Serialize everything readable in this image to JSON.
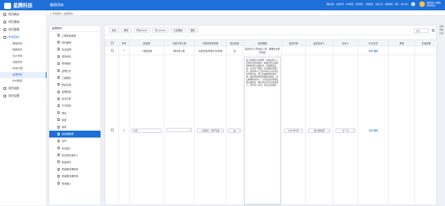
{
  "app": {
    "brand": "星腾科技",
    "brand_sub": "XINGTENG TECHNOLOGY",
    "project": "策网项目"
  },
  "topbar": {
    "items": [
      "模板切换",
      "在线打印",
      "BIM模型",
      "项目统计",
      "归档模式",
      "在线工具",
      "编辑资料",
      "图片",
      "账户中心"
    ],
    "user_name": "策网用户(游客)",
    "user_role": "建筑单位"
  },
  "sidebar": {
    "items": [
      {
        "label": "项目概况",
        "icon": "home-icon"
      },
      {
        "label": "项目基础",
        "icon": "grid-icon"
      },
      {
        "label": "项目管理",
        "icon": "folder-icon"
      },
      {
        "label": "专项资料",
        "icon": "file-icon",
        "open": true
      }
    ],
    "subitems": [
      "基础资料",
      "勘察资料",
      "设计资料",
      "流程资料",
      "现场代理",
      "监理资料",
      "BIM数据"
    ],
    "active_sub": "监理资料",
    "bottom_items": [
      {
        "label": "项目组织",
        "icon": "org-icon"
      },
      {
        "label": "项目设置",
        "icon": "gear-icon"
      }
    ]
  },
  "breadcrumb": {
    "home": "专项资料",
    "current": "监理资料"
  },
  "tree": {
    "title": "监理资料",
    "items": [
      "工程质量管理",
      "材料管理",
      "安全监理",
      "现场动态",
      "现场组织",
      "监理日志",
      "工程报告",
      "例会实施",
      "监理检验",
      "会议记录",
      "平行检验",
      "旁站",
      "巡视",
      "验收",
      "危险源管理",
      "合同",
      "安全施工",
      "安全责任承担人",
      "质量责任",
      "质量整改通知单",
      "质量整改通知单",
      "现场照片"
    ],
    "active_index": 14
  },
  "toolbar": {
    "add": "添加",
    "delete": "删除",
    "export": "导出Excel",
    "import": "导入Excel",
    "share": "分发模版",
    "template": "模板",
    "search_placeholder": "搜索"
  },
  "table": {
    "columns": [
      "",
      "序号",
      "危险源",
      "分部分项工程",
      "可能导致的事故",
      "是否危险",
      "控制措施",
      "监控时间",
      "监控负责人",
      "负责人",
      "作业情况",
      "其他",
      "关键设置"
    ],
    "rows": [
      {
        "no": "1",
        "hazard": "一般危险源",
        "sub": "脚手架工程",
        "accident": "高处坠落/物体打击/坍塌",
        "danger": "否",
        "measure": "高处作业人员持证上岗，配备安全防护用品",
        "time": "",
        "monitor": "",
        "person": "",
        "status_link": "查看",
        "edit_link": "编辑"
      },
      {
        "no": "2",
        "hazard": "大风",
        "sub": "",
        "accident": "人员伤亡、财产损失",
        "danger": "是",
        "measure": "施工现场的大风预警，加强对施工人员的安全防护教育。提前对安全设施和构件进行全面检查，加固临时设施。关注天气预报，及时做好预警工作。遇六级以上大风时停止高处作业和吊装作业。施工机械做好防风措施。做好现场材料的覆盖和固定，防止物体坠落伤人。大风过后对现场设施全面检查，确认安全后方可恢复施工。落实专人负责，建立责任制度。",
        "time": "2022年4月",
        "monitor": "重大危险源",
        "person": "王一凡",
        "status_link": "查看",
        "edit_link": "编辑"
      }
    ]
  },
  "right_rail": [
    "功能",
    "帮助",
    "反馈"
  ]
}
